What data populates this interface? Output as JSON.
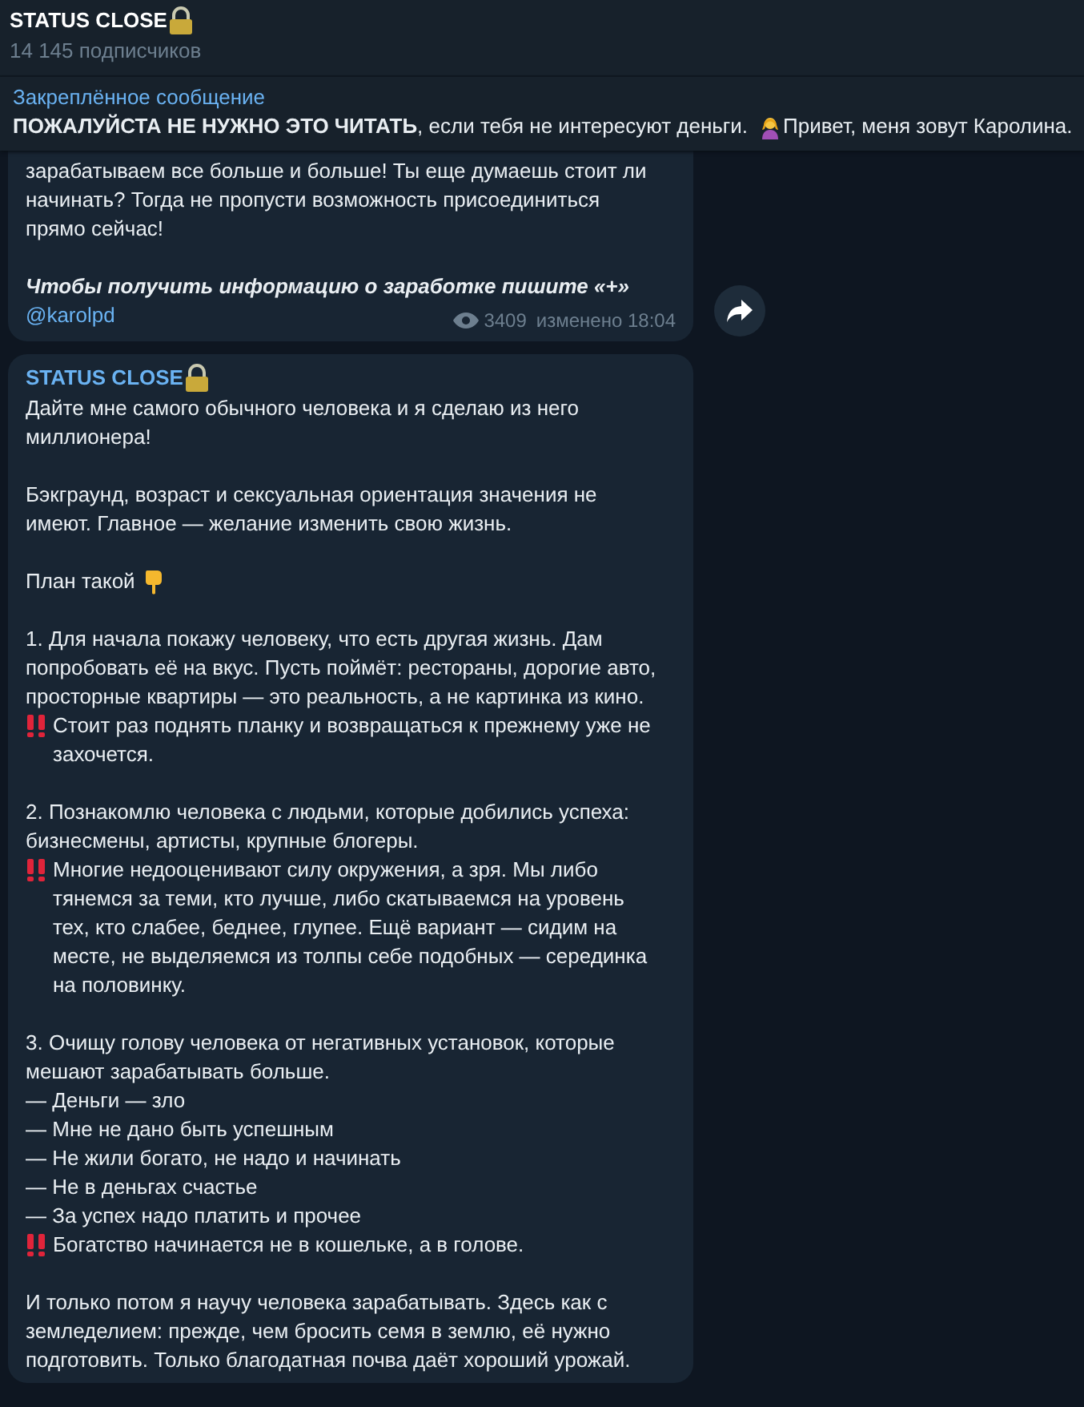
{
  "header": {
    "title": "STATUS CLOSE",
    "subtitle": "14 145 подписчиков"
  },
  "pinned": {
    "label": "Закреплённое сообщение",
    "text_before": "**ПОЖАЛУЙСТА НЕ НУЖНО ЭТО ЧИТАТЬ**, если тебя не интересуют деньги.",
    "text_after": "Привет, меня зовут Каролина."
  },
  "messages": [
    {
      "paragraphs": [
        [
          {
            "kind": "plain",
            "text": "зарабатываем все больше и больше! Ты еще думаешь стоит ли начинать? Тогда не пропусти возможность присоединиться прямо сейчас!"
          }
        ],
        [
          {
            "kind": "emphasis",
            "text": "Чтобы получить информацию о заработке пишите «+»"
          },
          {
            "kind": "link",
            "text": "@karolpd"
          }
        ]
      ],
      "views": "3409",
      "edited": "изменено 18:04",
      "forward": true
    },
    {
      "author": "STATUS CLOSE",
      "paragraphs": [
        [
          {
            "kind": "plain",
            "text": "Дайте мне самого обычного человека и я сделаю из него миллионера!"
          }
        ],
        [
          {
            "kind": "plain",
            "text": "Бэкграунд, возраст и сексуальная ориентация значения не имеют. Главное — желание изменить свою жизнь."
          }
        ],
        [
          {
            "kind": "pointer",
            "text": "План такой"
          }
        ],
        [
          {
            "kind": "plain",
            "text": "1. Для начала покажу человеку, что есть другая жизнь. Дам попробовать её на вкус. Пусть поймёт: рестораны, дорогие авто, просторные квартиры — это реальность, а не картинка из кино."
          },
          {
            "kind": "alert",
            "text": "Стоит раз поднять планку и возвращаться к прежнему уже не захочется."
          }
        ],
        [
          {
            "kind": "plain",
            "text": "2. Познакомлю человека с людьми, которые добились успеха: бизнесмены, артисты, крупные блогеры."
          },
          {
            "kind": "alert",
            "text": "Многие недооценивают силу окружения, а зря. Мы либо тянемся за теми, кто лучше, либо скатываемся на уровень тех, кто слабее, беднее, глупее. Ещё вариант — сидим на месте, не выделяемся из толпы себе подобных — серединка на половинку."
          }
        ],
        [
          {
            "kind": "plain",
            "text": "3. Очищу голову человека от негативных установок, которые мешают зарабатывать больше."
          },
          {
            "kind": "plain",
            "text": "— Деньги — зло"
          },
          {
            "kind": "plain",
            "text": "— Мне не дано быть успешным"
          },
          {
            "kind": "plain",
            "text": "— Не жили богато, не надо и начинать"
          },
          {
            "kind": "plain",
            "text": "— Не в деньгах счастье"
          },
          {
            "kind": "plain",
            "text": "— За успех надо платить и прочее"
          },
          {
            "kind": "alert",
            "text": "Богатство начинается не в кошельке, а в голове."
          }
        ],
        [
          {
            "kind": "plain",
            "text": "И только потом я научу человека зарабатывать. Здесь как с земледелием: прежде, чем бросить семя в землю, её нужно подготовить. Только благодатная почва даёт хороший урожай."
          }
        ]
      ]
    }
  ]
}
